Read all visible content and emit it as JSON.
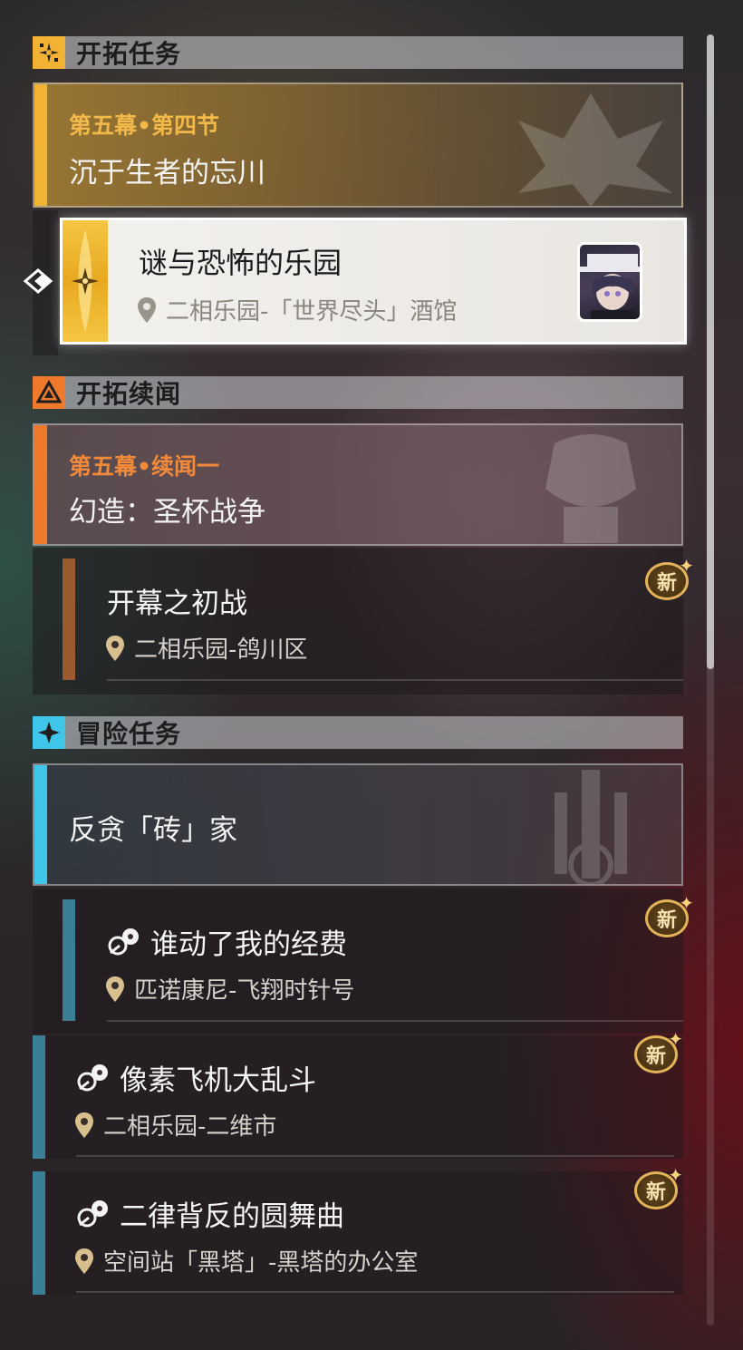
{
  "sections": {
    "trailblaze": {
      "title": "开拓任务"
    },
    "continuance": {
      "title": "开拓续闻"
    },
    "adventure": {
      "title": "冒险任务"
    }
  },
  "trailblaze_chapter": {
    "subtitle": "第五幕•第四节",
    "title": "沉于生者的忘川"
  },
  "trailblaze_quest": {
    "title": "谜与恐怖的乐园",
    "location": "二相乐园-「世界尽头」酒馆"
  },
  "continuance_chapter": {
    "subtitle": "第五幕•续闻一",
    "title": "幻造：圣杯战争"
  },
  "continuance_quest": {
    "title": "开幕之初战",
    "location": "二相乐园-鸽川区",
    "badge": "新"
  },
  "adventure_group": {
    "title": "反贪「砖」家"
  },
  "adventure_quests": [
    {
      "title": "谁动了我的经费",
      "location": "匹诺康尼-飞翔时针号",
      "badge": "新"
    },
    {
      "title": "像素飞机大乱斗",
      "location": "二相乐园-二维市",
      "badge": "新"
    },
    {
      "title": "二律背反的圆舞曲",
      "location": "空间站「黑塔」-黑塔的办公室",
      "badge": "新"
    }
  ],
  "colors": {
    "trailblaze_accent": "#f2b233",
    "continuance_accent": "#f07a2c",
    "adventure_accent": "#3fc6e8",
    "sub_bar_brown": "#9a5a30",
    "sub_bar_teal": "#3a7f95"
  }
}
